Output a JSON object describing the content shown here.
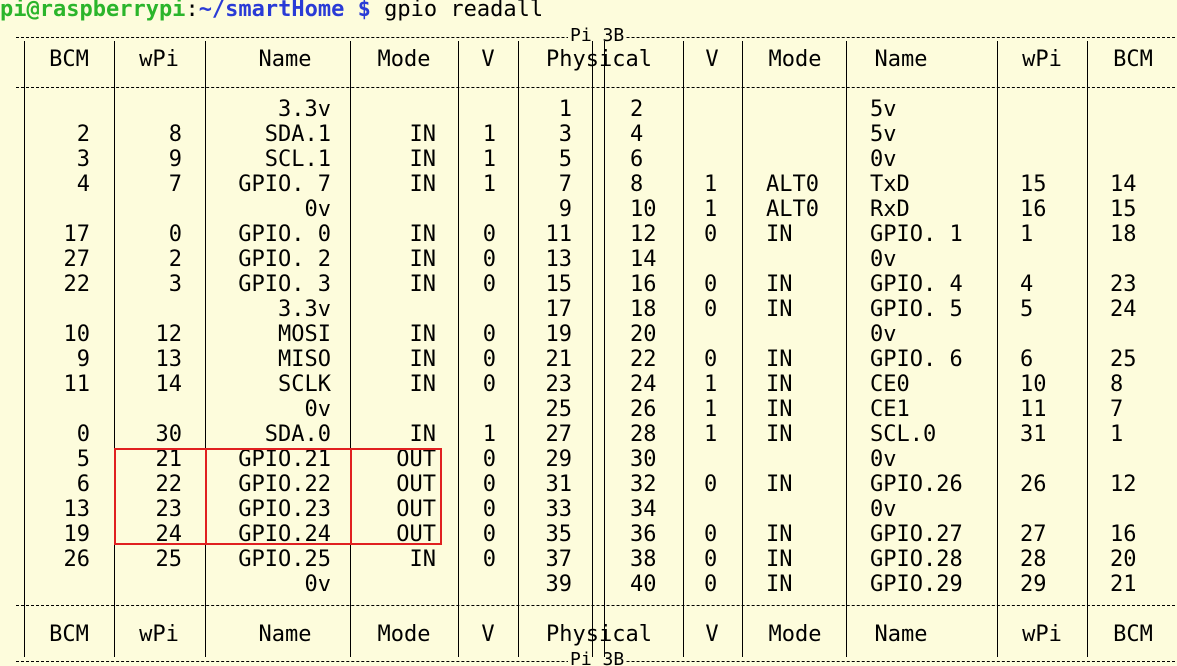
{
  "prompt": {
    "user_host": "pi@raspberrypi",
    "colon": ":",
    "path": "~/smartHome",
    "dollar": "$",
    "command": "gpio readall"
  },
  "board_label": "Pi 3B",
  "headers": [
    "BCM",
    "wPi",
    "Name",
    "Mode",
    "V",
    "Physical",
    "V",
    "Mode",
    "Name",
    "wPi",
    "BCM"
  ],
  "rows": [
    [
      "",
      "",
      "3.3v",
      "",
      "",
      "1",
      "2",
      "",
      "",
      "5v",
      "",
      ""
    ],
    [
      "2",
      "8",
      "SDA.1",
      "IN",
      "1",
      "3",
      "4",
      "",
      "",
      "5v",
      "",
      ""
    ],
    [
      "3",
      "9",
      "SCL.1",
      "IN",
      "1",
      "5",
      "6",
      "",
      "",
      "0v",
      "",
      ""
    ],
    [
      "4",
      "7",
      "GPIO. 7",
      "IN",
      "1",
      "7",
      "8",
      "1",
      "ALT0",
      "TxD",
      "15",
      "14"
    ],
    [
      "",
      "",
      "0v",
      "",
      "",
      "9",
      "10",
      "1",
      "ALT0",
      "RxD",
      "16",
      "15"
    ],
    [
      "17",
      "0",
      "GPIO. 0",
      "IN",
      "0",
      "11",
      "12",
      "0",
      "IN",
      "GPIO. 1",
      "1",
      "18"
    ],
    [
      "27",
      "2",
      "GPIO. 2",
      "IN",
      "0",
      "13",
      "14",
      "",
      "",
      "0v",
      "",
      ""
    ],
    [
      "22",
      "3",
      "GPIO. 3",
      "IN",
      "0",
      "15",
      "16",
      "0",
      "IN",
      "GPIO. 4",
      "4",
      "23"
    ],
    [
      "",
      "",
      "3.3v",
      "",
      "",
      "17",
      "18",
      "0",
      "IN",
      "GPIO. 5",
      "5",
      "24"
    ],
    [
      "10",
      "12",
      "MOSI",
      "IN",
      "0",
      "19",
      "20",
      "",
      "",
      "0v",
      "",
      ""
    ],
    [
      "9",
      "13",
      "MISO",
      "IN",
      "0",
      "21",
      "22",
      "0",
      "IN",
      "GPIO. 6",
      "6",
      "25"
    ],
    [
      "11",
      "14",
      "SCLK",
      "IN",
      "0",
      "23",
      "24",
      "1",
      "IN",
      "CE0",
      "10",
      "8"
    ],
    [
      "",
      "",
      "0v",
      "",
      "",
      "25",
      "26",
      "1",
      "IN",
      "CE1",
      "11",
      "7"
    ],
    [
      "0",
      "30",
      "SDA.0",
      "IN",
      "1",
      "27",
      "28",
      "1",
      "IN",
      "SCL.0",
      "31",
      "1"
    ],
    [
      "5",
      "21",
      "GPIO.21",
      "OUT",
      "0",
      "29",
      "30",
      "",
      "",
      "0v",
      "",
      ""
    ],
    [
      "6",
      "22",
      "GPIO.22",
      "OUT",
      "0",
      "31",
      "32",
      "0",
      "IN",
      "GPIO.26",
      "26",
      "12"
    ],
    [
      "13",
      "23",
      "GPIO.23",
      "OUT",
      "0",
      "33",
      "34",
      "",
      "",
      "0v",
      "",
      ""
    ],
    [
      "19",
      "24",
      "GPIO.24",
      "OUT",
      "0",
      "35",
      "36",
      "0",
      "IN",
      "GPIO.27",
      "27",
      "16"
    ],
    [
      "26",
      "25",
      "GPIO.25",
      "IN",
      "0",
      "37",
      "38",
      "0",
      "IN",
      "GPIO.28",
      "28",
      "20"
    ],
    [
      "",
      "",
      "0v",
      "",
      "",
      "39",
      "40",
      "0",
      "IN",
      "GPIO.29",
      "29",
      "21"
    ]
  ],
  "colors": {
    "background": "#fdfcdc",
    "prompt_user": "#2bb52b",
    "prompt_path": "#2a3bd6",
    "highlight": "#e02020"
  }
}
